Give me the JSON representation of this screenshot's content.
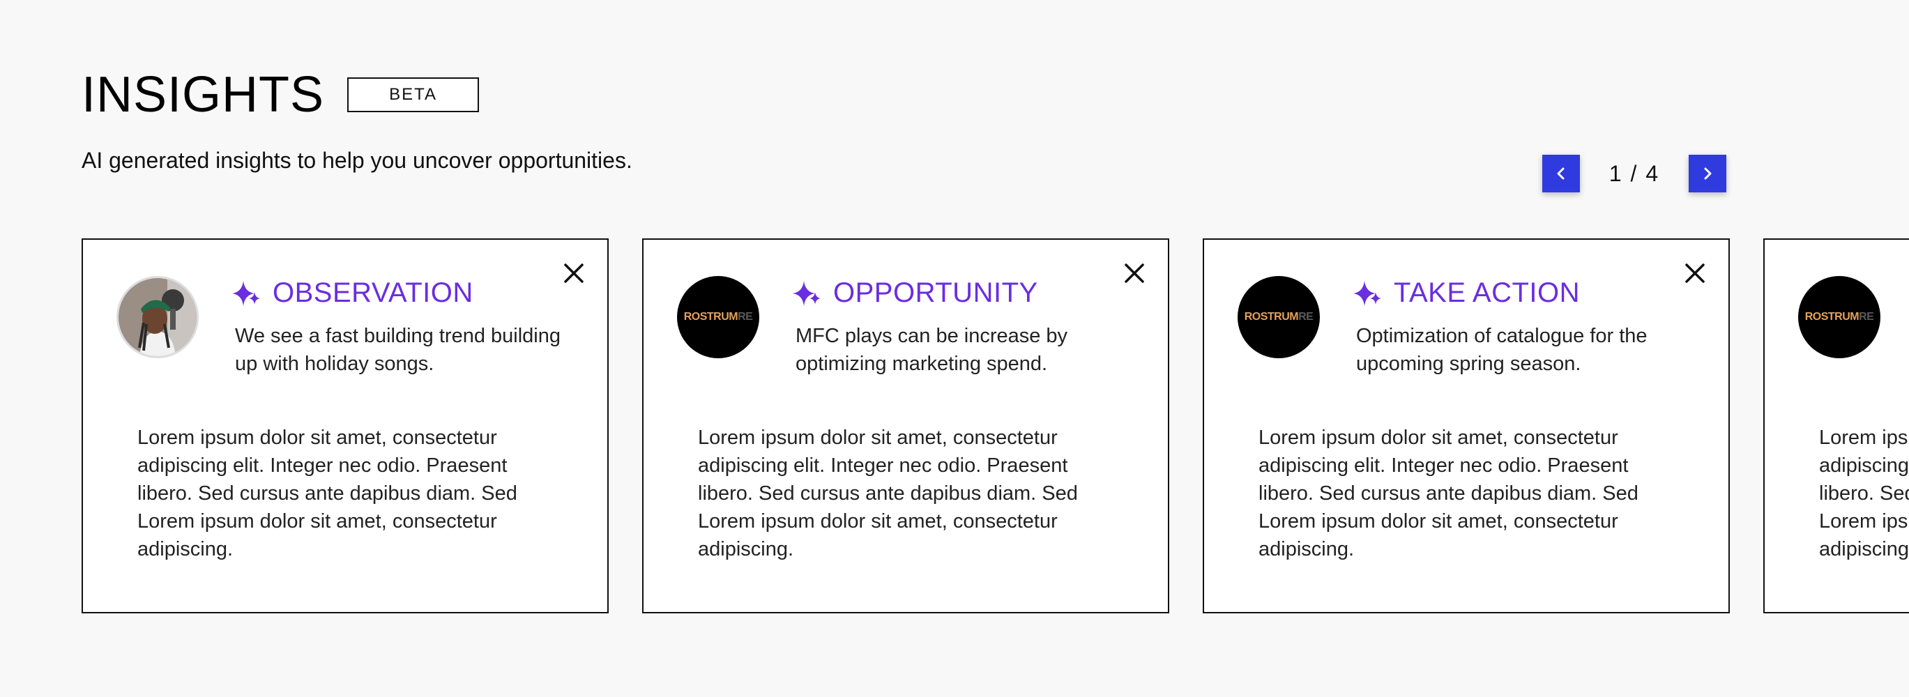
{
  "header": {
    "title": "INSIGHTS",
    "badge": "BETA",
    "subtitle": "AI generated insights to help you uncover opportunities."
  },
  "pager": {
    "current": "1",
    "separator": "/",
    "total": "4",
    "prev_icon": "chevron-left-icon",
    "next_icon": "chevron-right-icon"
  },
  "logo": {
    "part1": "ROSTRUM",
    "part2": "RE"
  },
  "cards": [
    {
      "type": "OBSERVATION",
      "summary": "We see a fast building trend building up with holiday songs.",
      "body": "Lorem ipsum dolor sit amet, consectetur adipiscing elit. Integer nec odio. Praesent libero. Sed cursus ante dapibus diam. Sed Lorem ipsum dolor sit amet, consectetur adipiscing.",
      "avatar": "artist-photo"
    },
    {
      "type": "OPPORTUNITY",
      "summary": "MFC plays can be increase by optimizing marketing spend.",
      "body": "Lorem ipsum dolor sit amet, consectetur adipiscing elit. Integer nec odio. Praesent libero. Sed cursus ante dapibus diam. Sed Lorem ipsum dolor sit amet, consectetur adipiscing.",
      "avatar": "label-logo"
    },
    {
      "type": "TAKE ACTION",
      "summary": "Optimization of catalogue for the upcoming spring season.",
      "body": "Lorem ipsum dolor sit amet, consectetur adipiscing elit. Integer nec odio. Praesent libero. Sed cursus ante dapibus diam. Sed Lorem ipsum dolor sit amet, consectetur adipiscing.",
      "avatar": "label-logo"
    },
    {
      "type": "",
      "summary": "",
      "body": "Lorem ipsum dolor sit amet, consectetur adipiscing elit. Integer nec odio. Praesent libero. Sed cursus ante dapibus diam. Sed Lorem ipsum dolor sit amet, consectetur adipiscing.",
      "avatar": "label-logo"
    }
  ],
  "colors": {
    "accent": "#6a2de0",
    "pager_button": "#2f3bdf",
    "background": "#f8f8f8"
  }
}
